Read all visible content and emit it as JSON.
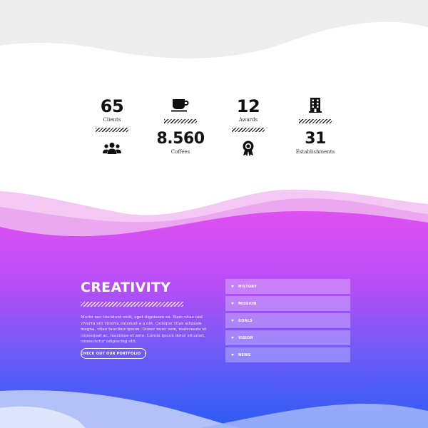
{
  "stats": [
    {
      "number": "65",
      "label": "Clients",
      "icon": "users-icon"
    },
    {
      "number": "8.560",
      "label": "Coffees",
      "icon": "coffee-cup-icon"
    },
    {
      "number": "12",
      "label": "Awards",
      "icon": "award-ribbon-icon"
    },
    {
      "number": "31",
      "label": "Establishments",
      "icon": "building-icon"
    }
  ],
  "creativity": {
    "title": "CREATIVITY",
    "body": "Morbi nec tincidunt velit, eget dignissim ex. Nam vitae nisl viverra elit viverra euismod a a elit. Quisque vitae aliquam magna, vitae faucibus ipsum. Donec nunc sem, malesuada ut consequat ac, maximus et ante. Lorem ipsum dolor sit amet, consectetur adipiscing elit.",
    "button_label": "CHECK OUT OUR PORTFOLIO"
  },
  "accordion": {
    "items": [
      "HISTORY",
      "MISSION",
      "GOALS",
      "VISION",
      "NEWS"
    ]
  },
  "colors": {
    "gradient_top": "#d94ff0",
    "gradient_mid": "#9b4ef5",
    "gradient_bottom": "#2c5ef5",
    "top_wave": "#ededed"
  }
}
